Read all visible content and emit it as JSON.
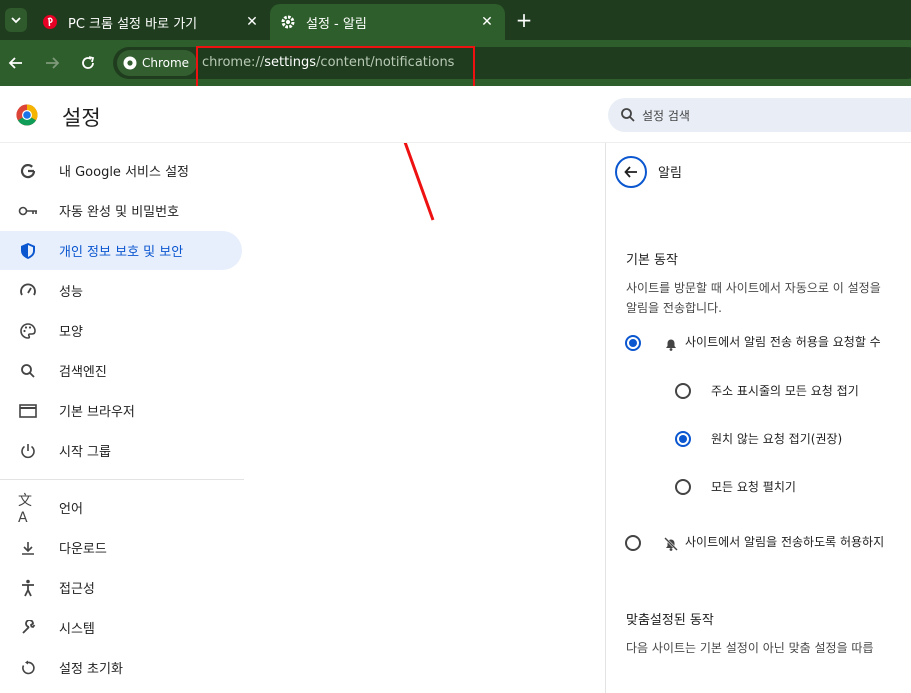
{
  "tabs": [
    {
      "title": "PC 크롬 설정 바로 가기",
      "active": false,
      "favicon": "pinterest-icon"
    },
    {
      "title": "설정 - 알림",
      "active": true,
      "favicon": "gear-icon"
    }
  ],
  "toolbar": {
    "chip_label": "Chrome",
    "url_prefix": "chrome://",
    "url_host": "settings",
    "url_path": "/content/notifications"
  },
  "header": {
    "title": "설정",
    "search_placeholder": "설정 검색"
  },
  "sidebar": {
    "items": [
      {
        "label": "내 Google 서비스 설정",
        "icon": "google-icon",
        "active": false
      },
      {
        "label": "자동 완성 및 비밀번호",
        "icon": "key-icon",
        "active": false
      },
      {
        "label": "개인 정보 보호 및 보안",
        "icon": "shield-icon",
        "active": true
      },
      {
        "label": "성능",
        "icon": "speedometer-icon",
        "active": false
      },
      {
        "label": "모양",
        "icon": "palette-icon",
        "active": false
      },
      {
        "label": "검색엔진",
        "icon": "search-icon",
        "active": false
      },
      {
        "label": "기본 브라우저",
        "icon": "browser-icon",
        "active": false
      },
      {
        "label": "시작 그룹",
        "icon": "power-icon",
        "active": false
      },
      {
        "label": "언어",
        "icon": "translate-icon",
        "active": false
      },
      {
        "label": "다운로드",
        "icon": "download-icon",
        "active": false
      },
      {
        "label": "접근성",
        "icon": "accessibility-icon",
        "active": false
      },
      {
        "label": "시스템",
        "icon": "wrench-icon",
        "active": false
      },
      {
        "label": "설정 초기화",
        "icon": "reset-icon",
        "active": false
      }
    ]
  },
  "content": {
    "page_title": "알림",
    "default_section_title": "기본 동작",
    "default_desc_line1": "사이트를 방문할 때 사이트에서 자동으로 이 설정을",
    "default_desc_line2": "알림을 전송합니다.",
    "option_allow": "사이트에서 알림 전송 허용을 요청할 수",
    "sub_option_1": "주소 표시줄의 모든 요청 접기",
    "sub_option_2": "원치 않는 요청 접기(권장)",
    "sub_option_3": "모든 요청 펼치기",
    "option_block": "사이트에서 알림을 전송하도록 허용하지",
    "custom_section_title": "맞춤설정된 동작",
    "custom_desc": "다음 사이트는 기본 설정이 아닌 맞춤 설정을 따릅"
  },
  "colors": {
    "tabbar_bg": "#1f3d1e",
    "toolbar_bg": "#2e5e2b",
    "accent": "#0b57d0",
    "annotation_red": "#ee1111"
  }
}
